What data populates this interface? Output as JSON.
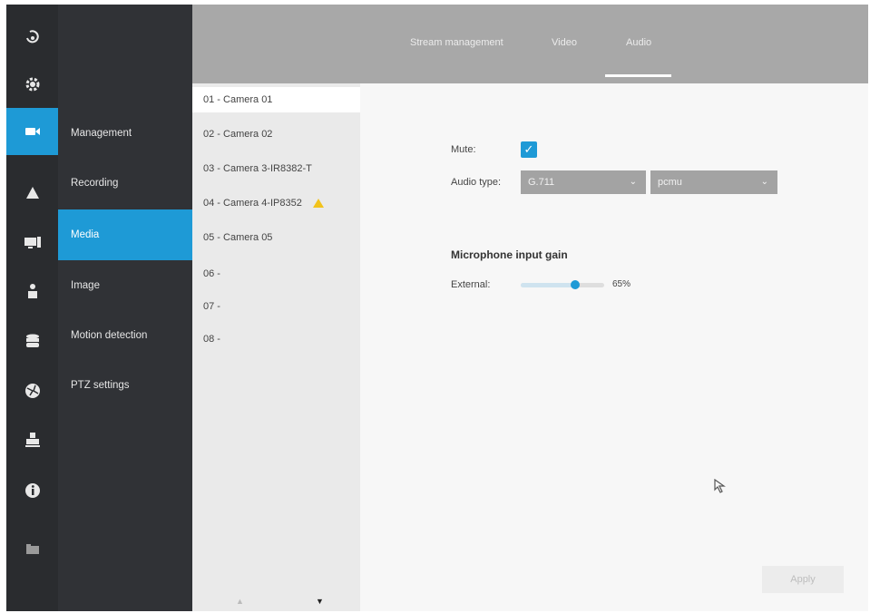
{
  "tabs": [
    {
      "label": "Stream management",
      "active": false
    },
    {
      "label": "Video",
      "active": false
    },
    {
      "label": "Audio",
      "active": true
    }
  ],
  "rail_icons": [
    "live-view-icon",
    "settings-gear-icon",
    "video-camera-icon",
    "alarm-bell-icon",
    "display-icon",
    "user-icon",
    "storage-database-icon",
    "network-globe-icon",
    "print-system-icon",
    "info-icon",
    "folder-icon"
  ],
  "nav": {
    "items": [
      {
        "label": "Management"
      },
      {
        "label": "Recording"
      },
      {
        "label": "Media",
        "active": true
      },
      {
        "label": "Image"
      },
      {
        "label": "Motion detection"
      },
      {
        "label": "PTZ settings"
      }
    ]
  },
  "cameras": [
    {
      "label": "01 - Camera 01",
      "active": true
    },
    {
      "label": "02 - Camera 02"
    },
    {
      "label": "03 - Camera 3-IR8382-T"
    },
    {
      "label": "04 - Camera 4-IP8352",
      "warning": true
    },
    {
      "label": "05 - Camera 05"
    },
    {
      "label": "06 -"
    },
    {
      "label": "07 -"
    },
    {
      "label": "08 -"
    }
  ],
  "audio": {
    "mute_label": "Mute:",
    "mute_checked": true,
    "audio_type_label": "Audio type:",
    "codec": "G.711",
    "mode": "pcmu",
    "section_title": "Microphone input gain",
    "external_label": "External:",
    "gain_value": 65,
    "gain_text": "65%"
  },
  "apply_label": "Apply",
  "colors": {
    "accent": "#1e9ad6",
    "rail": "#2a2c2f",
    "nav": "#303236",
    "topbar": "#a8a8a8"
  }
}
